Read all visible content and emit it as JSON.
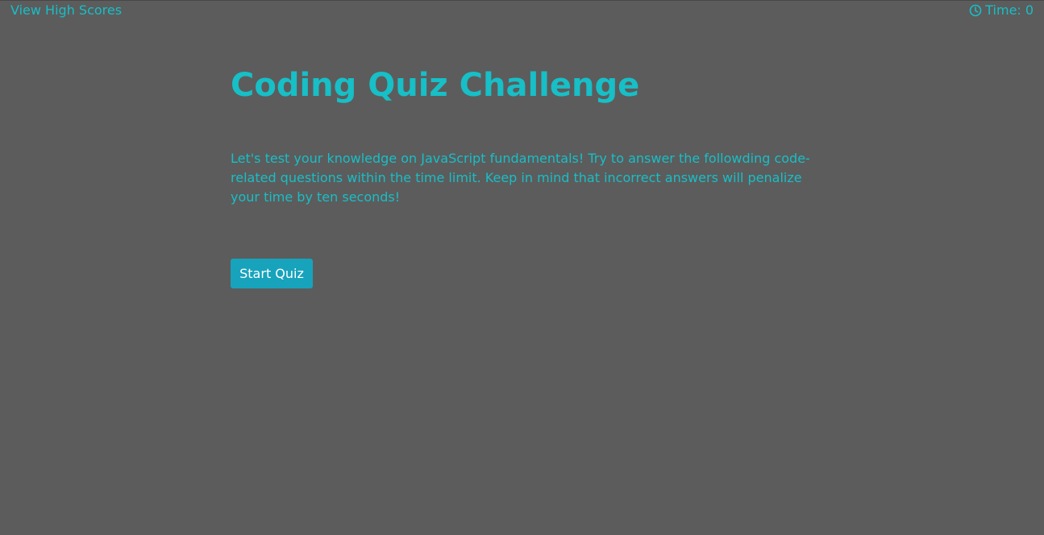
{
  "nav": {
    "high_scores_label": "View High Scores"
  },
  "timer": {
    "icon": "clock-icon",
    "label": "Time:",
    "value": "0"
  },
  "main": {
    "title": "Coding Quiz Challenge",
    "intro": "Let's test your knowledge on JavaScript fundamentals! Try to answer the followding code-related questions within the time limit. Keep in mind that incorrect answers will penalize your time by ten seconds!",
    "start_button_label": "Start Quiz"
  },
  "colors": {
    "background": "#5c5c5c",
    "accent": "#17bfc7",
    "button": "#17a3bc",
    "button_text": "#ffffff"
  }
}
